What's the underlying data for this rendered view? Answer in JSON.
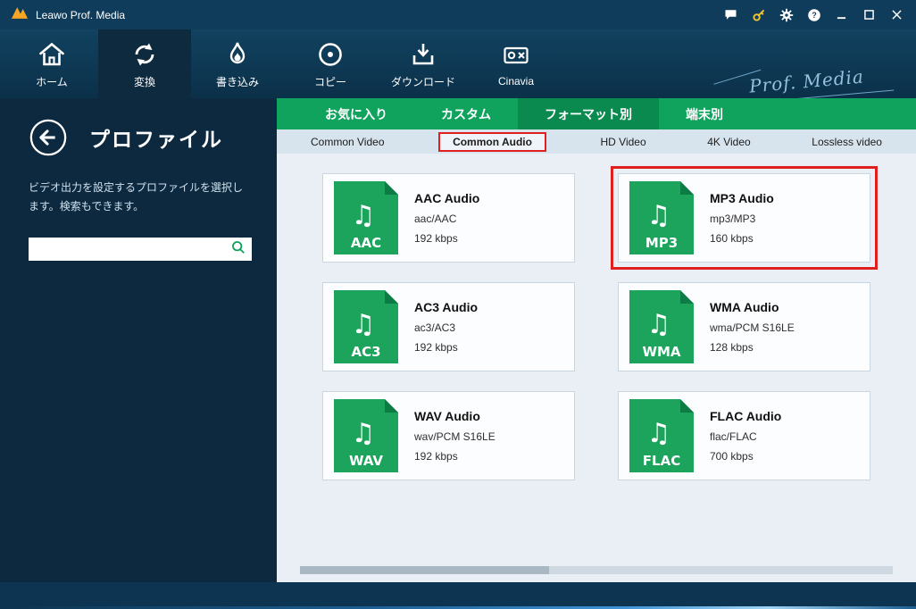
{
  "colors": {
    "titlebar_blue": "#0f3c5a",
    "sidebar_navy": "#0c2940",
    "accent_green": "#0fa35e",
    "accent_green_dark": "#0b8a4f",
    "file_icon_green": "#1ca45c",
    "annotation_red": "#e01f1f",
    "key_yellow": "#f3c52e"
  },
  "titlebar": {
    "title": "Leawo Prof. Media",
    "help_glyph": "?"
  },
  "brand": {
    "text": "Prof. Media"
  },
  "nav": {
    "items": [
      {
        "label": "ホーム"
      },
      {
        "label": "変換"
      },
      {
        "label": "書き込み"
      },
      {
        "label": "コピー"
      },
      {
        "label": "ダウンロード"
      },
      {
        "label": "Cinavia"
      }
    ]
  },
  "sidebar": {
    "title": "プロファイル",
    "description": "ビデオ出力を設定するプロファイルを選択します。検索もできます。",
    "search_value": "",
    "search_placeholder": ""
  },
  "tabs": {
    "primary": [
      {
        "label": "お気に入り"
      },
      {
        "label": "カスタム"
      },
      {
        "label": "フォーマット別"
      },
      {
        "label": "端末別"
      }
    ],
    "secondary": [
      {
        "label": "Common Video"
      },
      {
        "label": "Common Audio"
      },
      {
        "label": "HD Video"
      },
      {
        "label": "4K Video"
      },
      {
        "label": "Lossless video"
      }
    ]
  },
  "icons": {
    "music_note": "♫"
  },
  "profiles": [
    {
      "badge": "AAC",
      "title": "AAC Audio",
      "codec": "aac/AAC",
      "bitrate": "192 kbps"
    },
    {
      "badge": "MP3",
      "title": "MP3 Audio",
      "codec": "mp3/MP3",
      "bitrate": "160 kbps"
    },
    {
      "badge": "AC3",
      "title": "AC3 Audio",
      "codec": "ac3/AC3",
      "bitrate": "192 kbps"
    },
    {
      "badge": "WMA",
      "title": "WMA Audio",
      "codec": "wma/PCM S16LE",
      "bitrate": "128 kbps"
    },
    {
      "badge": "WAV",
      "title": "WAV Audio",
      "codec": "wav/PCM S16LE",
      "bitrate": "192 kbps"
    },
    {
      "badge": "FLAC",
      "title": "FLAC Audio",
      "codec": "flac/FLAC",
      "bitrate": "700 kbps"
    }
  ]
}
